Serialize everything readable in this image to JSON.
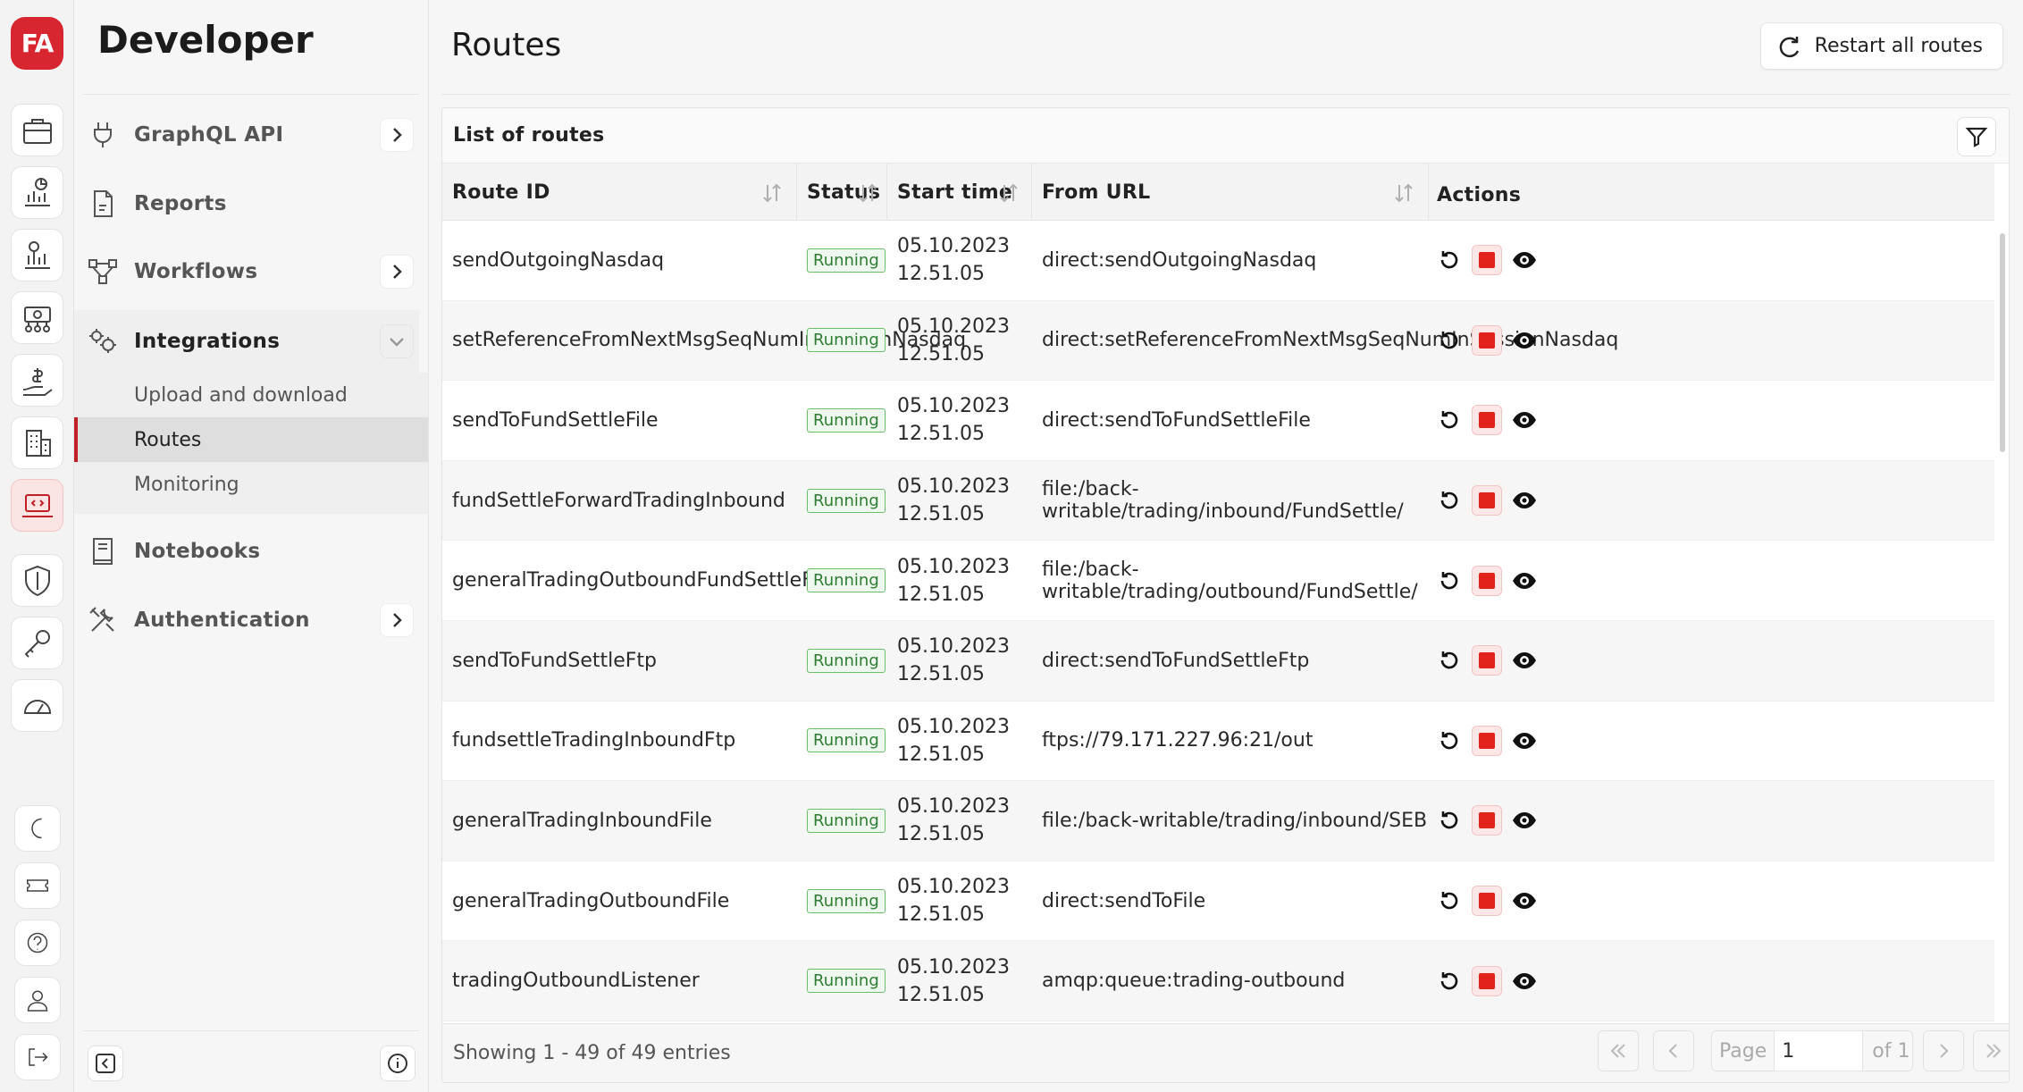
{
  "app": {
    "logo_text": "FA",
    "section_title": "Developer"
  },
  "colors": {
    "brand": "#d7262f",
    "running_border": "#6bbf6b",
    "running_text": "#2e7d32",
    "stop": "#e1231c"
  },
  "rail": {
    "top_icons": [
      "briefcase-icon",
      "portfolio-chart-icon",
      "report-chart-icon",
      "money-network-icon",
      "payment-hand-icon",
      "building-icon",
      "developer-laptop-icon",
      "shield-icon",
      "key-icon",
      "dashboard-gauge-icon"
    ],
    "bottom_icons": [
      "moon-icon",
      "ticket-icon",
      "help-icon",
      "user-icon",
      "logout-icon"
    ]
  },
  "nav": {
    "items": [
      {
        "label": "GraphQL API",
        "icon": "plug-icon",
        "has_chevron": true
      },
      {
        "label": "Reports",
        "icon": "document-icon",
        "has_chevron": false
      },
      {
        "label": "Workflows",
        "icon": "workflow-icon",
        "has_chevron": true
      },
      {
        "label": "Integrations",
        "icon": "gears-icon",
        "has_chevron": true,
        "expanded": true
      },
      {
        "label": "Notebooks",
        "icon": "notebook-icon",
        "has_chevron": false
      },
      {
        "label": "Authentication",
        "icon": "tools-icon",
        "has_chevron": true
      }
    ],
    "integrations_sub": [
      {
        "label": "Upload and download"
      },
      {
        "label": "Routes",
        "active": true
      },
      {
        "label": "Monitoring"
      }
    ]
  },
  "page": {
    "title": "Routes",
    "restart_all_label": "Restart all routes"
  },
  "table": {
    "title": "List of routes",
    "columns": [
      "Route ID",
      "Status",
      "Start time",
      "From URL",
      "Actions"
    ],
    "rows": [
      {
        "route_id": "sendOutgoingNasdaq",
        "status": "Running",
        "date": "05.10.2023",
        "time": "12.51.05",
        "from_url": "direct:sendOutgoingNasdaq"
      },
      {
        "route_id": "setReferenceFromNextMsgSeqNumInSessionNasdaq",
        "status": "Running",
        "date": "05.10.2023",
        "time": "12.51.05",
        "from_url": "direct:setReferenceFromNextMsgSeqNumInSessionNasdaq"
      },
      {
        "route_id": "sendToFundSettleFile",
        "status": "Running",
        "date": "05.10.2023",
        "time": "12.51.05",
        "from_url": "direct:sendToFundSettleFile"
      },
      {
        "route_id": "fundSettleForwardTradingInbound",
        "status": "Running",
        "date": "05.10.2023",
        "time": "12.51.05",
        "from_url": "file:/back-writable/trading/inbound/FundSettle/"
      },
      {
        "route_id": "generalTradingOutboundFundSettleFile",
        "status": "Running",
        "date": "05.10.2023",
        "time": "12.51.05",
        "from_url": "file:/back-writable/trading/outbound/FundSettle/"
      },
      {
        "route_id": "sendToFundSettleFtp",
        "status": "Running",
        "date": "05.10.2023",
        "time": "12.51.05",
        "from_url": "direct:sendToFundSettleFtp"
      },
      {
        "route_id": "fundsettleTradingInboundFtp",
        "status": "Running",
        "date": "05.10.2023",
        "time": "12.51.05",
        "from_url": "ftps://79.171.227.96:21/out"
      },
      {
        "route_id": "generalTradingInboundFile",
        "status": "Running",
        "date": "05.10.2023",
        "time": "12.51.05",
        "from_url": "file:/back-writable/trading/inbound/SEB"
      },
      {
        "route_id": "generalTradingOutboundFile",
        "status": "Running",
        "date": "05.10.2023",
        "time": "12.51.05",
        "from_url": "direct:sendToFile"
      },
      {
        "route_id": "tradingOutboundListener",
        "status": "Running",
        "date": "05.10.2023",
        "time": "12.51.05",
        "from_url": "amqp:queue:trading-outbound"
      }
    ],
    "footer": {
      "showing": "Showing 1 - 49 of 49 entries",
      "page_label": "Page",
      "page_value": "1",
      "of_label": "of 1"
    }
  }
}
